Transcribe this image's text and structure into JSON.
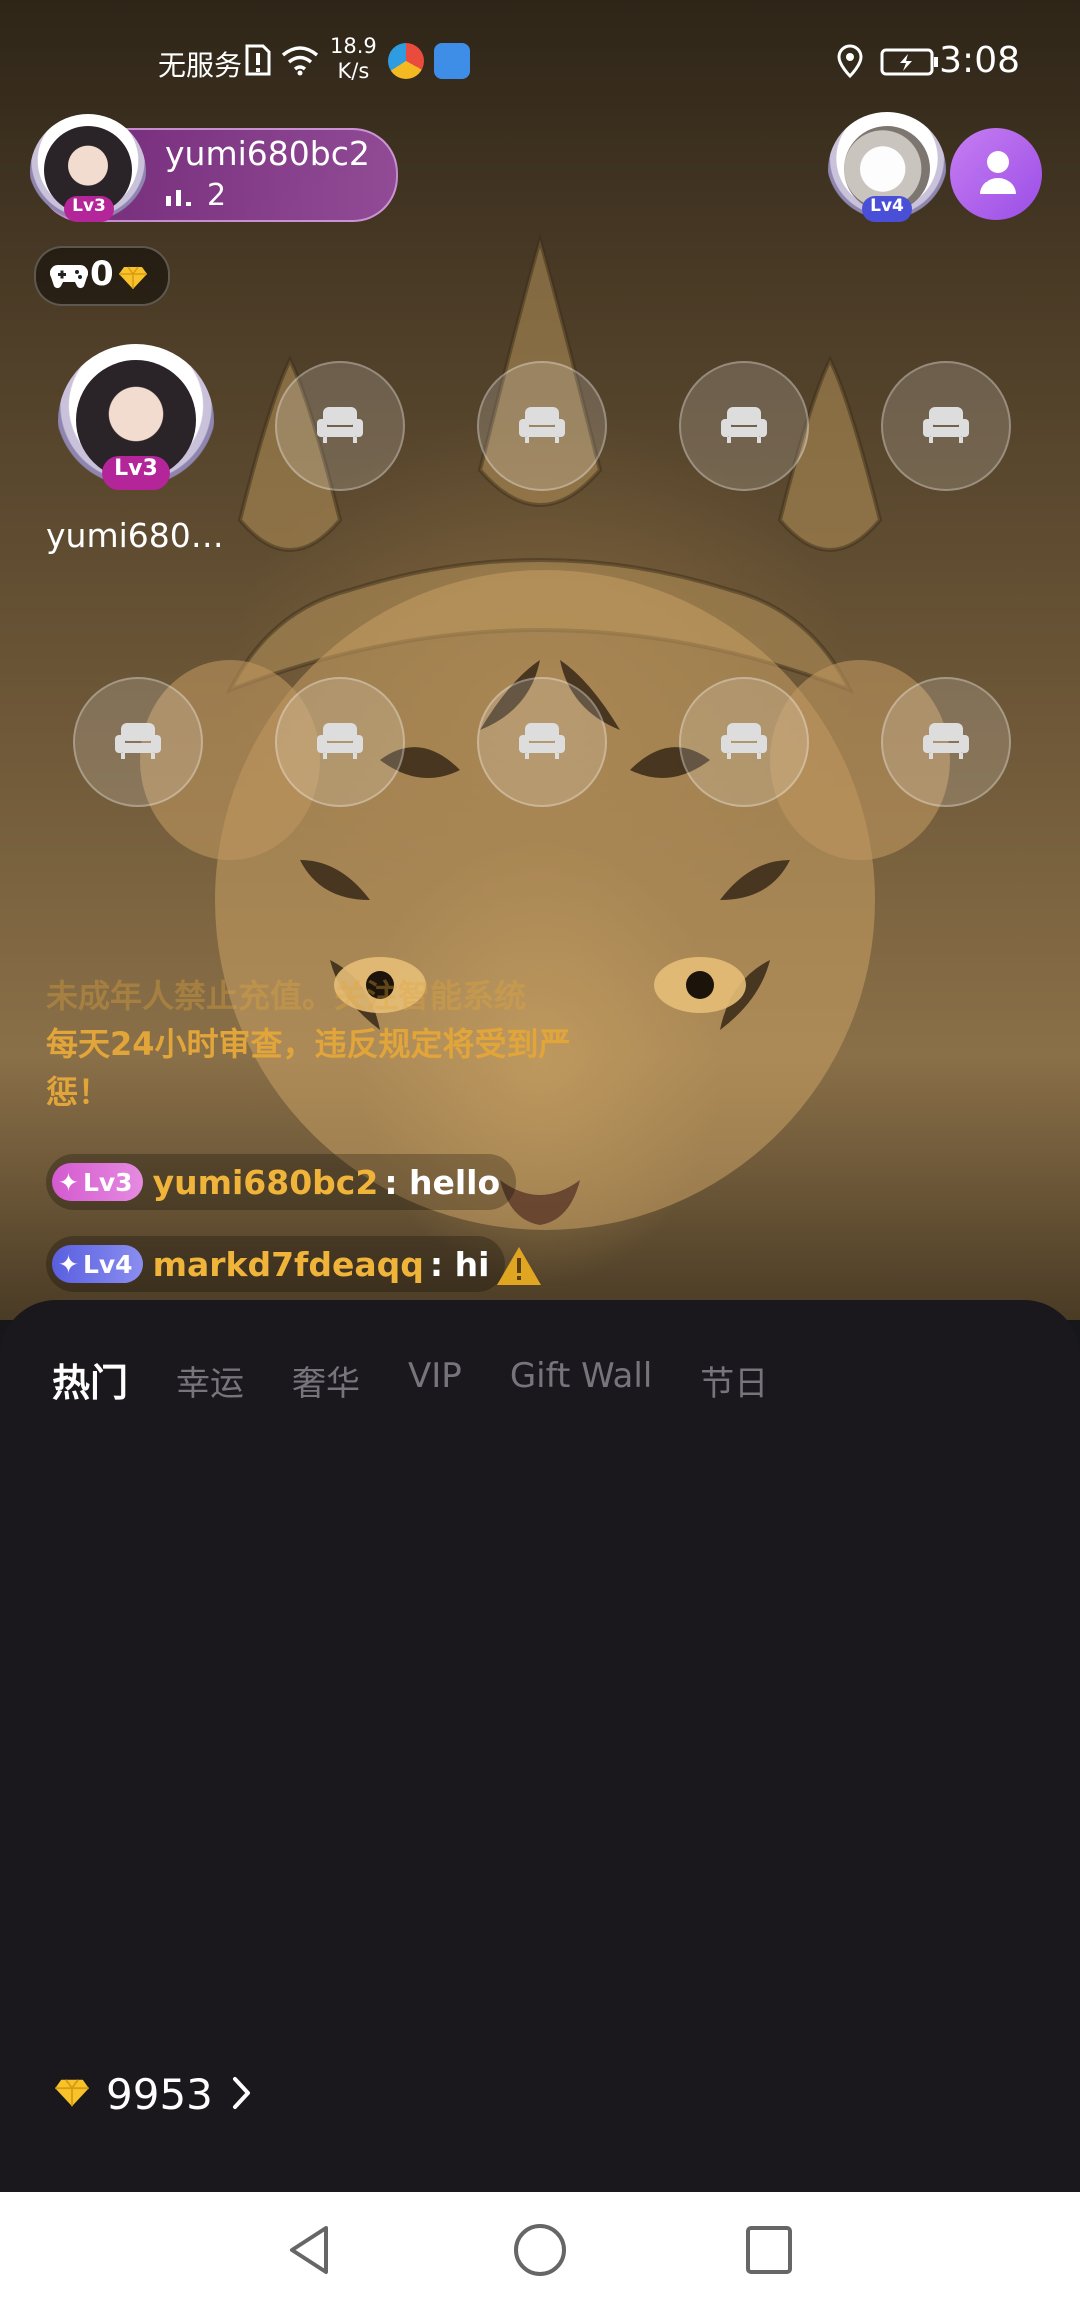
{
  "status_bar": {
    "carrier": "无服务",
    "net_speed_value": "18.9",
    "net_speed_unit": "K/s",
    "time": "3:08"
  },
  "host": {
    "name": "yumi680bc2",
    "level": "Lv3",
    "online_count": "2",
    "diamond_count": "0"
  },
  "viewer": {
    "level": "Lv4"
  },
  "seats": {
    "occupied_name": "yumi680b...",
    "occupied_level": "Lv3"
  },
  "notice": {
    "line1": "未成年人禁止充值。关注智能系统",
    "line2": "每天24小时审查，违反规定将受到严",
    "line3": "惩！"
  },
  "chat": [
    {
      "level": "Lv3",
      "user": "yumi680bc2",
      "message": ": hello"
    },
    {
      "level": "Lv4",
      "user": "markd7fdeaqq",
      "message": ": hi"
    }
  ],
  "gift_panel": {
    "tabs": [
      "热门",
      "幸运",
      "奢华",
      "VIP",
      "Gift Wall",
      "节日"
    ],
    "active_tab": "热门",
    "balance": "9953"
  },
  "colors": {
    "accent_purple": "#9b4ee6",
    "chat_username": "#f0b43a",
    "sheet_bg": "#1a181c"
  },
  "icons": [
    "sim-error-icon",
    "wifi-icon",
    "location-icon",
    "battery-icon",
    "signal-bars-icon",
    "gamepad-icon",
    "diamond-icon",
    "members-icon",
    "sofa-seat-icon",
    "warning-icon",
    "chevron-right-icon",
    "nav-back-icon",
    "nav-home-icon",
    "nav-recents-icon"
  ]
}
